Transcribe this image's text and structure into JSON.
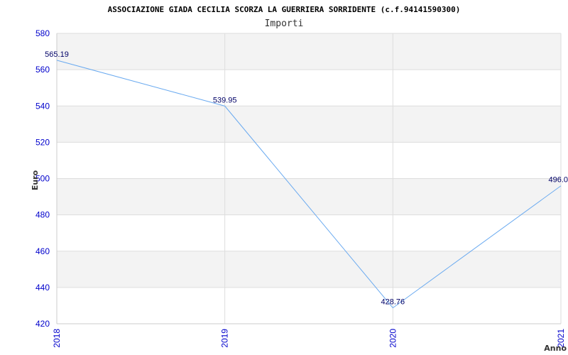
{
  "chart_data": {
    "type": "line",
    "title": "ASSOCIAZIONE GIADA CECILIA SCORZA LA GUERRIERA SORRIDENTE (c.f.94141590300)",
    "subtitle": "Importi",
    "xlabel": "Anno",
    "ylabel": "Euro",
    "categories": [
      "2018",
      "2019",
      "2020",
      "2021"
    ],
    "series": [
      {
        "values": [
          565.19,
          539.95,
          428.76,
          496.0
        ],
        "labels": [
          "565.19",
          "539.95",
          "428.76",
          "496.0"
        ],
        "color": "#6aaaf0"
      }
    ],
    "ylim": [
      420,
      580
    ],
    "yticks": [
      "420",
      "440",
      "460",
      "480",
      "500",
      "520",
      "540",
      "560",
      "580"
    ],
    "grid": true,
    "band_color": "#f3f3f3",
    "gridline_color": "#dddddd"
  }
}
